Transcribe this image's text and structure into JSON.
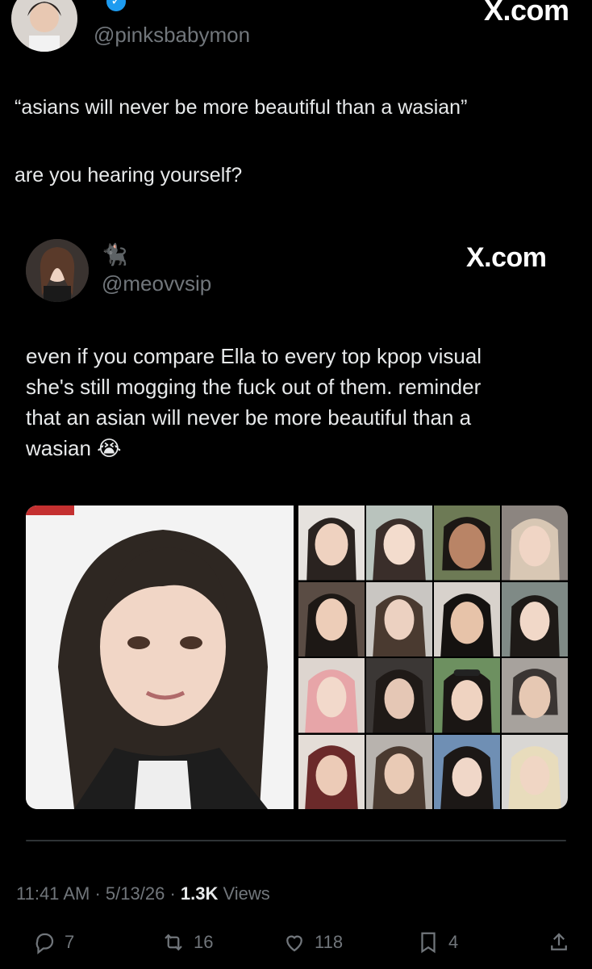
{
  "main_tweet": {
    "handle": "@pinksbabymon",
    "site": "X.com",
    "text_line1": "“asians will never be more beautiful than a wasian”",
    "text_line2": "are you hearing yourself?"
  },
  "quoted_tweet": {
    "name_emoji": "🐈‍⬛",
    "handle": "@meovvsip",
    "site": "X.com",
    "text_lines": [
      "even if you compare Ella to every top kpop visual",
      "she's still mogging the fuck out of them. reminder",
      "that an asian will never be more beautiful than a",
      "wasian 😭"
    ]
  },
  "meta": {
    "time": "11:41 AM",
    "date": "5/13/26",
    "views_count": "1.3K",
    "views_label": "Views"
  },
  "actions": {
    "replies": "7",
    "reposts": "16",
    "likes": "118",
    "bookmarks": "4"
  },
  "colors": {
    "background": "#000000",
    "text": "#e7e9ea",
    "muted": "#71767b",
    "verified": "#1d9bf0"
  }
}
